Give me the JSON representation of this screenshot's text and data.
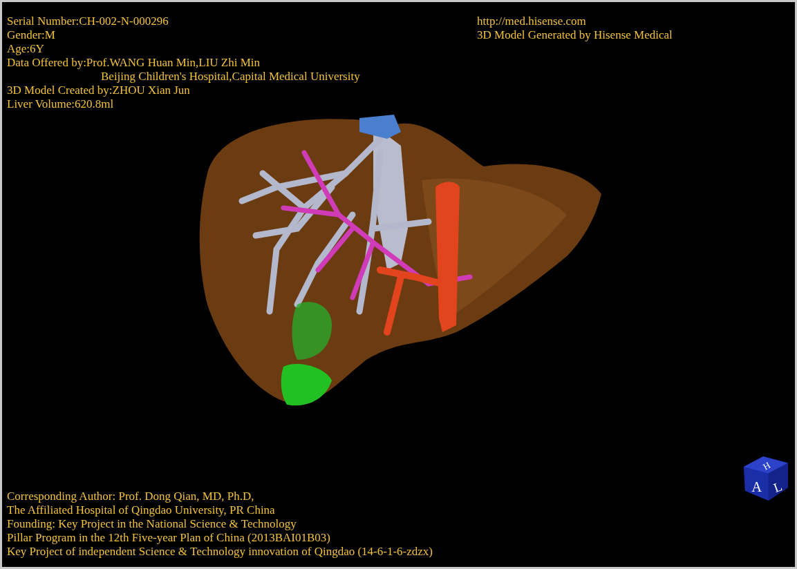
{
  "patient_info": [
    {
      "text": "Serial Number:CH-002-N-000296",
      "indented": false
    },
    {
      "text": "Gender:M",
      "indented": false
    },
    {
      "text": "Age:6Y",
      "indented": false
    },
    {
      "text": "Data Offered by:Prof.WANG Huan Min,LIU Zhi Min",
      "indented": false
    },
    {
      "text": "Beijing Children's Hospital,Capital Medical University",
      "indented": true
    },
    {
      "text": "3D Model Created by:ZHOU Xian Jun",
      "indented": false
    },
    {
      "text": "Liver Volume:620.8ml",
      "indented": false
    }
  ],
  "generator_info": [
    "http://med.hisense.com",
    "3D Model Generated by Hisense Medical"
  ],
  "credits": [
    "Corresponding Author: Prof. Dong Qian, MD, Ph.D,",
    "The Affiliated Hospital of Qingdao University, PR China",
    "Founding: Key Project in the National Science & Technology",
    "Pillar Program in the 12th Five-year Plan of China (2013BAI01B03)",
    "Key Project of independent Science & Technology innovation of Qingdao (14-6-1-6-zdzx)"
  ],
  "orientation_cube": {
    "labels": [
      "H",
      "A",
      "L"
    ]
  }
}
